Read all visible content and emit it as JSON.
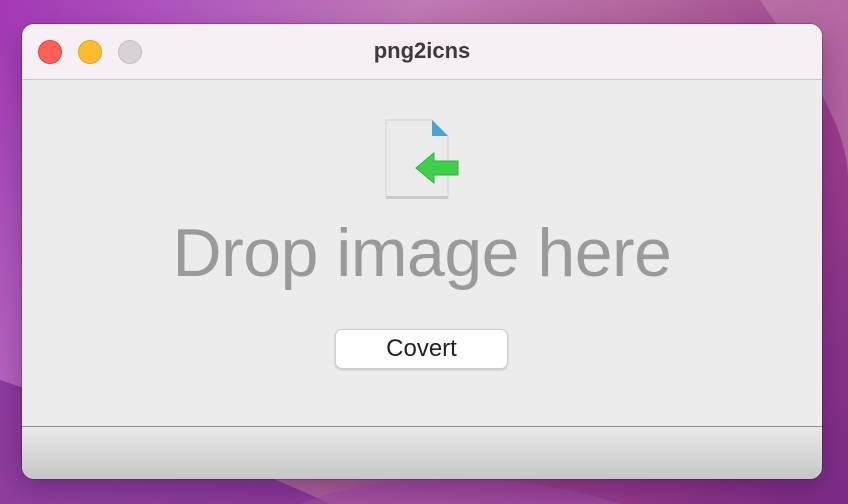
{
  "window": {
    "title": "png2icns",
    "controls": {
      "close_color": "#fe5f57",
      "minimize_color": "#febc2e",
      "zoom_color": "#d6d2d6"
    }
  },
  "main": {
    "drop_icon": "file-import-icon",
    "drop_label": "Drop image here",
    "convert_button_label": "Covert"
  },
  "colors": {
    "arrow_green": "#3fd149",
    "corner_blue": "#4aa3d8",
    "label_gray": "#9a9a9a"
  }
}
